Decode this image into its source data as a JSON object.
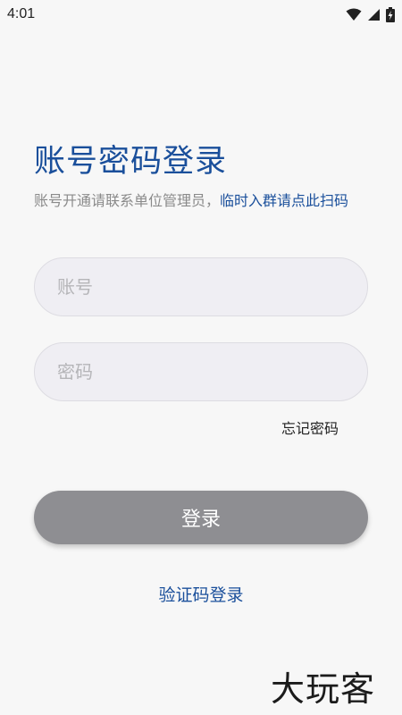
{
  "status_bar": {
    "time": "4:01",
    "icons": [
      "wifi-icon",
      "cellular-signal-icon",
      "battery-charging-icon"
    ]
  },
  "header": {
    "title": "账号密码登录",
    "subtitle_text": "账号开通请联系单位管理员，",
    "subtitle_link": "临时入群请点此扫码"
  },
  "form": {
    "account_placeholder": "账号",
    "password_placeholder": "密码",
    "forgot_label": "忘记密码",
    "login_label": "登录"
  },
  "footer": {
    "code_login_label": "验证码登录"
  },
  "watermark": {
    "text": "大玩客"
  },
  "colors": {
    "accent": "#1a4f9b",
    "button_bg": "#8e8e92",
    "field_bg": "#efeef3",
    "page_bg": "#f7f7f7"
  }
}
